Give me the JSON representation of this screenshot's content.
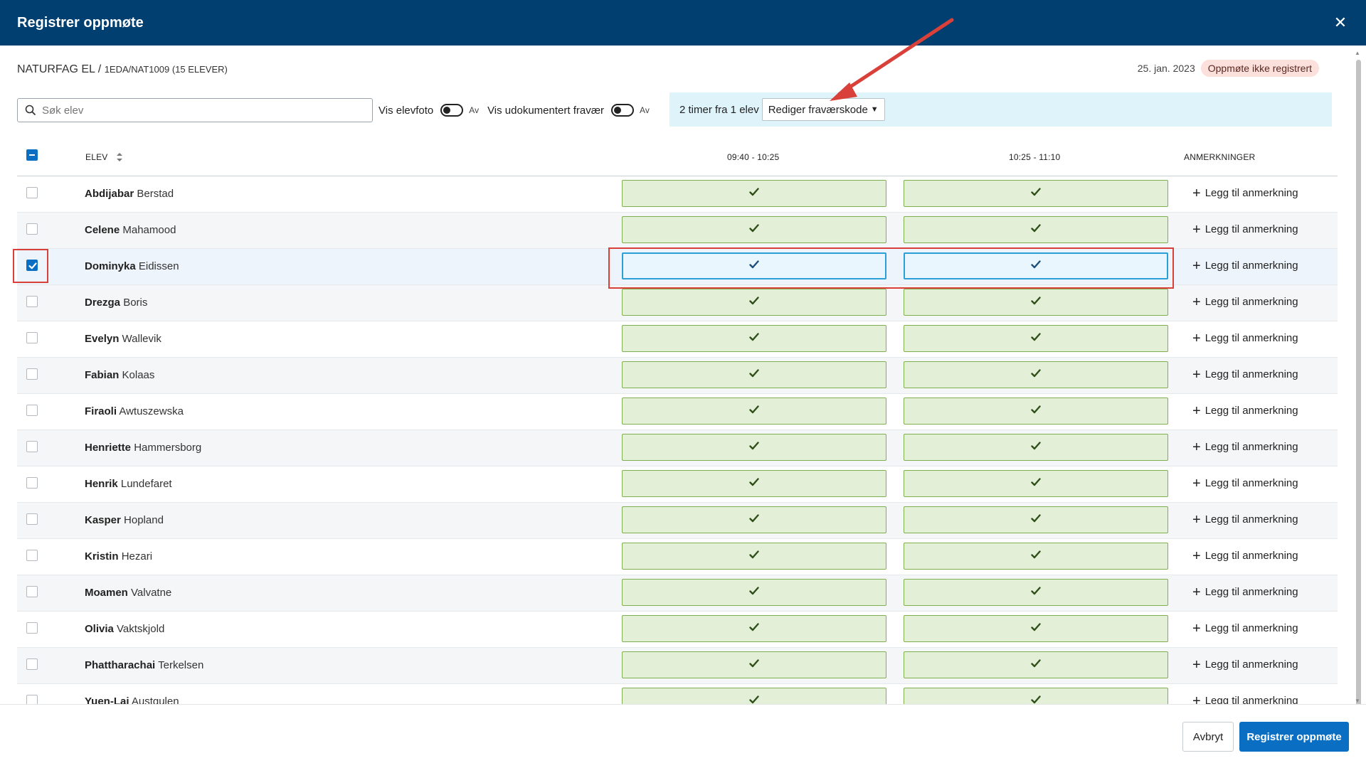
{
  "dialog": {
    "title": "Registrer oppmøte",
    "close_icon": "close-icon"
  },
  "course": {
    "name": "NATURFAG EL / ",
    "code": "1EDA/NAT1009 (15 ELEVER)"
  },
  "status": {
    "date": "25. jan. 2023",
    "badge": "Oppmøte ikke registrert"
  },
  "search": {
    "placeholder": "Søk elev",
    "value": ""
  },
  "toggles": [
    {
      "label": "Vis elevfoto",
      "state": "Av"
    },
    {
      "label": "Vis udokumentert fravær",
      "state": "Av"
    }
  ],
  "selection": {
    "summary": "2 timer fra 1 elev",
    "edit_label": "Rediger fraværskode"
  },
  "columns": {
    "student": "ELEV",
    "period1": "09:40 - 10:25",
    "period2": "10:25 - 11:10",
    "notes": "ANMERKNINGER"
  },
  "add_note_label": "Legg til anmerkning",
  "students": [
    {
      "first": "Abdijabar",
      "last": "Berstad",
      "selected": false
    },
    {
      "first": "Celene",
      "last": "Mahamood",
      "selected": false
    },
    {
      "first": "Dominyka",
      "last": "Eidissen",
      "selected": true
    },
    {
      "first": "Drezga",
      "last": "Boris",
      "selected": false
    },
    {
      "first": "Evelyn",
      "last": "Wallevik",
      "selected": false
    },
    {
      "first": "Fabian",
      "last": "Kolaas",
      "selected": false
    },
    {
      "first": "Firaoli",
      "last": "Awtuszewska",
      "selected": false
    },
    {
      "first": "Henriette",
      "last": "Hammersborg",
      "selected": false
    },
    {
      "first": "Henrik",
      "last": "Lundefaret",
      "selected": false
    },
    {
      "first": "Kasper",
      "last": "Hopland",
      "selected": false
    },
    {
      "first": "Kristin",
      "last": "Hezari",
      "selected": false
    },
    {
      "first": "Moamen",
      "last": "Valvatne",
      "selected": false
    },
    {
      "first": "Olivia",
      "last": "Vaktskjold",
      "selected": false
    },
    {
      "first": "Phattharachai",
      "last": "Terkelsen",
      "selected": false
    },
    {
      "first": "Yuen-Lai",
      "last": "Austgulen",
      "selected": false
    }
  ],
  "footer": {
    "cancel_label": "Avbryt",
    "submit_label": "Registrer oppmøte"
  },
  "colors": {
    "header": "#003f6f",
    "primary": "#0a6fc2",
    "present_bg": "#e3efd6",
    "present_border": "#7fb04f",
    "highlight": "#d9403a"
  }
}
